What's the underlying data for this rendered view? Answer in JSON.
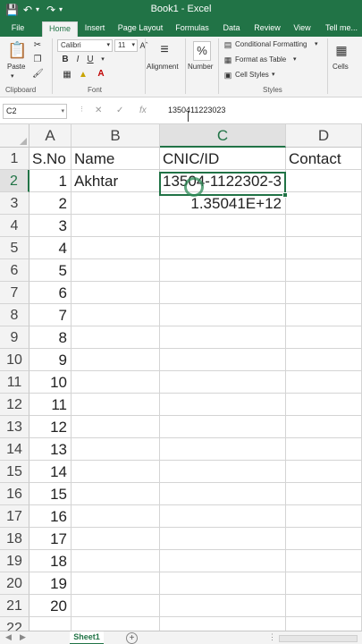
{
  "titlebar": {
    "title": "Book1 - Excel",
    "save_icon": "save-icon",
    "undo_icon": "undo-icon",
    "redo_icon": "redo-icon"
  },
  "tabs": [
    "File",
    "Home",
    "Insert",
    "Page Layout",
    "Formulas",
    "Data",
    "Review",
    "View",
    "Tell me..."
  ],
  "ribbon": {
    "clipboard": {
      "paste_label": "Paste",
      "group_label": "Clipboard"
    },
    "font": {
      "font_name": "Calibri",
      "font_size": "11",
      "bold": "B",
      "italic": "I",
      "underline": "U",
      "group_label": "Font"
    },
    "alignment_label": "Alignment",
    "number": {
      "label": "Number",
      "icon_text": "%"
    },
    "styles": {
      "conditional_formatting": "Conditional Formatting",
      "format_as_table": "Format as Table",
      "cell_styles": "Cell Styles",
      "group_label": "Styles"
    },
    "cells_label": "Cells"
  },
  "formula_bar": {
    "name_box": "C2",
    "value": "1350411223023",
    "cancel": "✕",
    "enter": "✓",
    "fx": "fx"
  },
  "columns": [
    "A",
    "B",
    "C",
    "D"
  ],
  "rows": [
    {
      "row": "1",
      "a": "S.No",
      "b": "Name",
      "c": "CNIC/ID",
      "d": "Contact"
    },
    {
      "row": "2",
      "a": "1",
      "b": "Akhtar",
      "c": "13504-1122302-3",
      "d": ""
    },
    {
      "row": "3",
      "a": "2",
      "b": "",
      "c": "1.35041E+12",
      "d": ""
    },
    {
      "row": "4",
      "a": "3",
      "b": "",
      "c": "",
      "d": ""
    },
    {
      "row": "5",
      "a": "4",
      "b": "",
      "c": "",
      "d": ""
    },
    {
      "row": "6",
      "a": "5",
      "b": "",
      "c": "",
      "d": ""
    },
    {
      "row": "7",
      "a": "6",
      "b": "",
      "c": "",
      "d": ""
    },
    {
      "row": "8",
      "a": "7",
      "b": "",
      "c": "",
      "d": ""
    },
    {
      "row": "9",
      "a": "8",
      "b": "",
      "c": "",
      "d": ""
    },
    {
      "row": "10",
      "a": "9",
      "b": "",
      "c": "",
      "d": ""
    },
    {
      "row": "11",
      "a": "10",
      "b": "",
      "c": "",
      "d": ""
    },
    {
      "row": "12",
      "a": "11",
      "b": "",
      "c": "",
      "d": ""
    },
    {
      "row": "13",
      "a": "12",
      "b": "",
      "c": "",
      "d": ""
    },
    {
      "row": "14",
      "a": "13",
      "b": "",
      "c": "",
      "d": ""
    },
    {
      "row": "15",
      "a": "14",
      "b": "",
      "c": "",
      "d": ""
    },
    {
      "row": "16",
      "a": "15",
      "b": "",
      "c": "",
      "d": ""
    },
    {
      "row": "17",
      "a": "16",
      "b": "",
      "c": "",
      "d": ""
    },
    {
      "row": "18",
      "a": "17",
      "b": "",
      "c": "",
      "d": ""
    },
    {
      "row": "19",
      "a": "18",
      "b": "",
      "c": "",
      "d": ""
    },
    {
      "row": "20",
      "a": "19",
      "b": "",
      "c": "",
      "d": ""
    },
    {
      "row": "21",
      "a": "20",
      "b": "",
      "c": "",
      "d": ""
    },
    {
      "row": "22",
      "a": "",
      "b": "",
      "c": "",
      "d": ""
    }
  ],
  "selected_cell": "C2",
  "sheets": [
    "Sheet1"
  ],
  "colors": {
    "accent": "#217346",
    "header_bg": "#f3f3f3",
    "grid_line": "#d4d4d4"
  }
}
